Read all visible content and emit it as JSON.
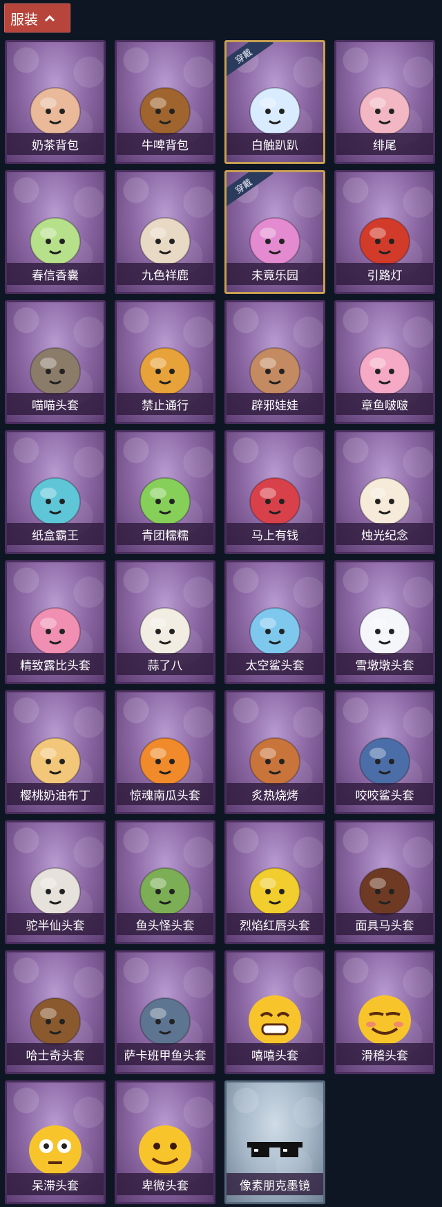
{
  "header": {
    "title": "服装",
    "toggle_icon": "chevron-up-icon"
  },
  "badge_text": "穿戴",
  "items": [
    {
      "name": "奶茶背包",
      "icon": "milk-tea-backpack-icon",
      "color": "#e9b99a"
    },
    {
      "name": "牛啤背包",
      "icon": "cow-beer-backpack-icon",
      "color": "#a0652f"
    },
    {
      "name": "白触趴趴",
      "icon": "white-plush-icon",
      "color": "#d9ecff",
      "equipped": true
    },
    {
      "name": "绯尾",
      "icon": "fox-charm-icon",
      "color": "#f2b7c2"
    },
    {
      "name": "春信香囊",
      "icon": "sachet-icon",
      "color": "#b6e08a"
    },
    {
      "name": "九色祥鹿",
      "icon": "deer-icon",
      "color": "#e8d9c4"
    },
    {
      "name": "未竟乐园",
      "icon": "doll-icon",
      "color": "#e38ad0",
      "equipped": true
    },
    {
      "name": "引路灯",
      "icon": "lantern-icon",
      "color": "#d23a2a"
    },
    {
      "name": "喵喵头套",
      "icon": "cat-head-icon",
      "color": "#8b7c6a"
    },
    {
      "name": "禁止通行",
      "icon": "barrier-icon",
      "color": "#e8a23a"
    },
    {
      "name": "辟邪娃娃",
      "icon": "girl-head-icon",
      "color": "#c48a62"
    },
    {
      "name": "章鱼啵啵",
      "icon": "octopus-icon",
      "color": "#f5a9c4"
    },
    {
      "name": "纸盒霸王",
      "icon": "box-dino-icon",
      "color": "#5fc6d8"
    },
    {
      "name": "青团糯糯",
      "icon": "green-bun-icon",
      "color": "#86d05a"
    },
    {
      "name": "马上有钱",
      "icon": "red-horse-icon",
      "color": "#d8414a"
    },
    {
      "name": "烛光纪念",
      "icon": "candle-icon",
      "color": "#f6ead8"
    },
    {
      "name": "精致露比头套",
      "icon": "pink-beaver-icon",
      "color": "#f08fb2"
    },
    {
      "name": "蒜了八",
      "icon": "garlic-icon",
      "color": "#f1ede2"
    },
    {
      "name": "太空鲨头套",
      "icon": "space-shark-icon",
      "color": "#7ec8ee"
    },
    {
      "name": "雪墩墩头套",
      "icon": "snowman-icon",
      "color": "#f4f6fa"
    },
    {
      "name": "樱桃奶油布丁",
      "icon": "pudding-icon",
      "color": "#f3c77a"
    },
    {
      "name": "惊魂南瓜头套",
      "icon": "pumpkin-icon",
      "color": "#f08a2a"
    },
    {
      "name": "炙热烧烤",
      "icon": "bbq-icon",
      "color": "#c8743a"
    },
    {
      "name": "咬咬鲨头套",
      "icon": "shark-icon",
      "color": "#4b6ea8"
    },
    {
      "name": "驼半仙头套",
      "icon": "alpaca-sunglasses-icon",
      "color": "#e6e1da"
    },
    {
      "name": "鱼头怪头套",
      "icon": "fish-head-icon",
      "color": "#7cae55"
    },
    {
      "name": "烈焰红唇头套",
      "icon": "yellow-mask-icon",
      "color": "#f2cd2e"
    },
    {
      "name": "面具马头套",
      "icon": "horse-head-icon",
      "color": "#6e3a24"
    },
    {
      "name": "哈士奇头套",
      "icon": "husky-icon",
      "color": "#8a5a2e"
    },
    {
      "name": "萨卡班甲鱼头套",
      "icon": "sacabambaspis-icon",
      "color": "#5d7590"
    },
    {
      "name": "嘻嘻头套",
      "icon": "grin-emoji-icon",
      "color": "#f7c52b"
    },
    {
      "name": "滑稽头套",
      "icon": "smirk-emoji-icon",
      "color": "#f7c52b"
    },
    {
      "name": "呆滞头套",
      "icon": "stare-emoji-icon",
      "color": "#f7c52b"
    },
    {
      "name": "卑微头套",
      "icon": "humble-emoji-icon",
      "color": "#f7c52b"
    },
    {
      "name": "像素朋克墨镜",
      "icon": "pixel-sunglasses-icon",
      "color": "#111111",
      "grey": true
    }
  ]
}
